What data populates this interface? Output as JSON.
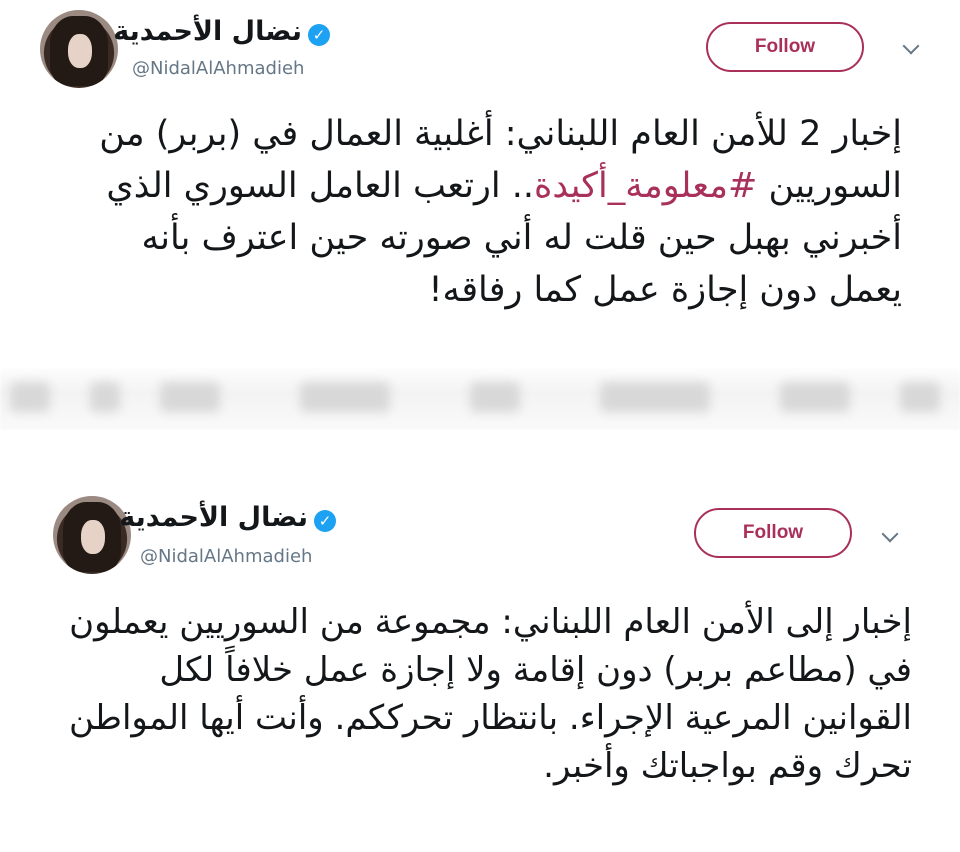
{
  "tweets": [
    {
      "display_name": "نضال الأحمدية",
      "handle": "@NidalAlAhmadieh",
      "follow_label": "Follow",
      "text_before_hashtag": "إخبار 2 للأمن العام اللبناني: أغلبية العمال في (بربر) من السوريين ",
      "hashtag": "#معلومة_أكيدة",
      "text_after_hashtag": ".. ارتعب العامل السوري الذي أخبرني بهبل حين قلت له أني صورته حين اعترف بأنه يعمل دون إجازة عمل كما رفاقه!"
    },
    {
      "display_name": "نضال الأحمدية",
      "handle": "@NidalAlAhmadieh",
      "follow_label": "Follow",
      "text": "إخبار إلى الأمن العام اللبناني: مجموعة من السوريين يعملون في (مطاعم بربر) دون إقامة ولا إجازة عمل خلافاً لكل القوانين المرعية الإجراء. بانتظار تحرككم. وأنت أيها المواطن تحرك وقم بواجباتك وأخبر."
    }
  ],
  "colors": {
    "follow": "#a8305a",
    "hashtag": "#a8305a",
    "verified": "#1da1f2",
    "handle": "#657786"
  },
  "icons": {
    "verified": "verified-badge-icon",
    "more": "chevron-down-icon"
  }
}
